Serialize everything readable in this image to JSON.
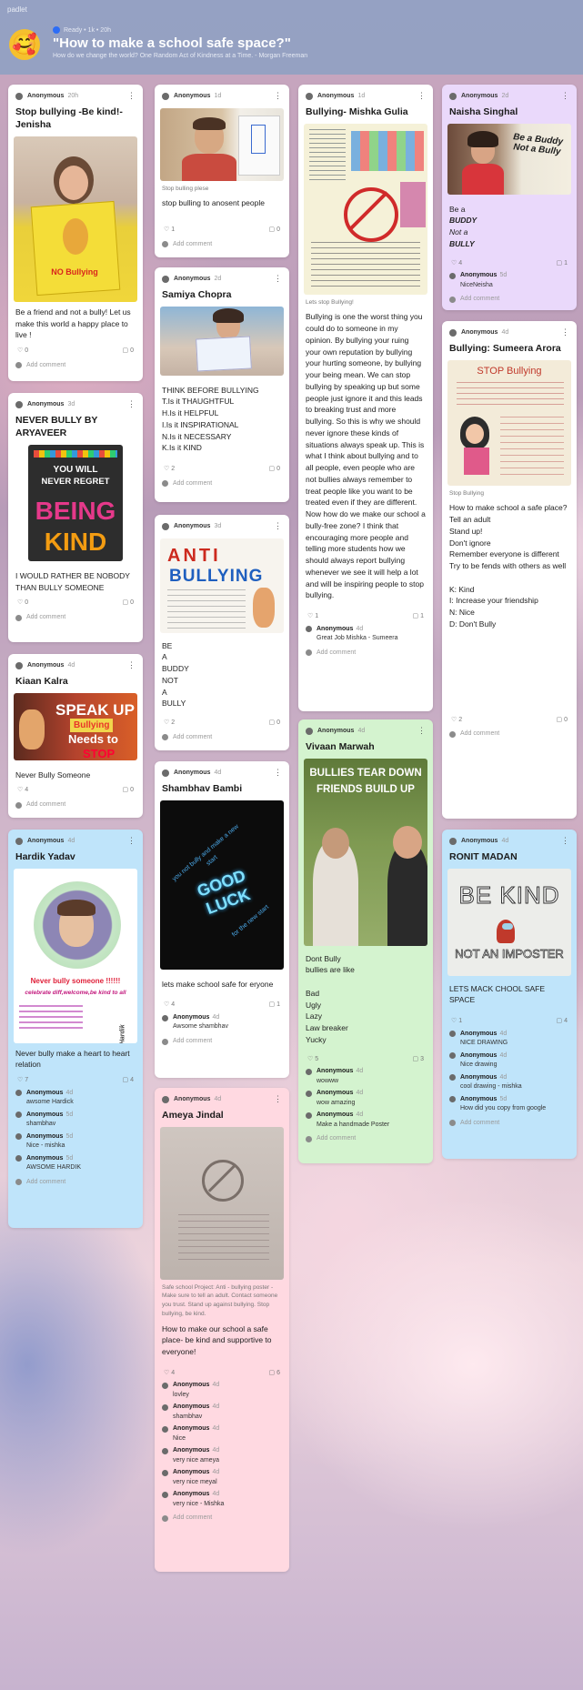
{
  "header": {
    "brand": "padlet",
    "owner_meta": "Ready • 1k • 20h",
    "title": "\"How to make a school safe space?\"",
    "subtitle": "How do we change the world? One Random Act of Kindness at a Time. - Morgan Freeman"
  },
  "posts": {
    "p1": {
      "author": "Anonymous",
      "time": "20h",
      "title": "Stop bullying -Be kind!- Jenisha",
      "body": "Be a friend and not a bully! Let us make this world a happy place to live !",
      "likes": "0",
      "comments": "0",
      "add": "Add comment",
      "img_text": "NO Bullying"
    },
    "p2": {
      "author": "Anonymous",
      "time": "1d",
      "caption": "Stop bulling plese",
      "body": "stop bulling to anosent people",
      "likes": "1",
      "comments": "0",
      "add": "Add comment"
    },
    "p3": {
      "author": "Anonymous",
      "time": "1d",
      "title": "Bullying- Mishka Gulia",
      "caption": "Lets stop Bullying!",
      "body": "Bullying is one the worst thing you could do to someone in my opinion. By bullying your ruing your own reputation by bullying your hurting someone, by bullying your being mean. We can stop bullying by speaking up but some people just ignore it and this leads to breaking trust and more bullying. So this is why we should never ignore these kinds of situations always speak up. This is what I think about bullying and to all people, even people who are not bullies always remember to treat people like you want to be treated even if they are different. Now how do we make our school a bully-free zone? I think that encouraging more people and telling more students how we should always report bullying whenever we see it will help a lot and will be inspiring people to stop bullying.",
      "likes": "1",
      "comments": "1",
      "add": "Add comment",
      "c1_name": "Anonymous",
      "c1_time": "4d",
      "c1_text": "Great Job Mishka - Sumeera"
    },
    "p4": {
      "author": "Anonymous",
      "time": "2d",
      "title": "Naisha Singhal",
      "b1": "Be a",
      "b2": "BUDDY",
      "b3": "Not a",
      "b4": "BULLY",
      "likes": "4",
      "comments": "1",
      "add": "Add comment",
      "c1_name": "Anonymous",
      "c1_time": "5d",
      "c1_text": "NiceNeisha",
      "img_text": "Be a Buddy Not a Bully"
    },
    "p5": {
      "author": "Anonymous",
      "time": "2d",
      "title": "Samiya Chopra",
      "lines": [
        "THINK BEFORE BULLYING",
        "T.Is it THAUGHTFUL",
        "H.Is it HELPFUL",
        "I.Is it INSPIRATIONAL",
        "N.Is it NECESSARY",
        "K.Is it KIND"
      ],
      "likes": "2",
      "comments": "0",
      "add": "Add comment"
    },
    "p6": {
      "author": "Anonymous",
      "time": "3d",
      "title": "NEVER BULLY BY ARYAVEER",
      "img_l1": "YOU WILL",
      "img_l2": "NEVER REGRET",
      "img_l3": "BEING",
      "img_l4": "KIND",
      "body": "I WOULD RATHER BE NOBODY THAN BULLY SOMEONE",
      "likes": "0",
      "comments": "0",
      "add": "Add comment"
    },
    "p7": {
      "author": "Anonymous",
      "time": "3d",
      "img_l1": "ANTI",
      "img_l2": "BULLYING",
      "lines": [
        "BE",
        "A",
        "BUDDY",
        "NOT",
        "A",
        "BULLY"
      ],
      "likes": "2",
      "comments": "0",
      "add": "Add comment"
    },
    "p8": {
      "author": "Anonymous",
      "time": "4d",
      "title": "Sumeera Arora",
      "title_prefix": "Bullying: ",
      "caption": "Stop Bullying",
      "body1": "How to make school a safe place?",
      "body2": "Tell an adult",
      "body3": "Stand up!",
      "body4": "Don't ignore",
      "body5": "Remember everyone is different",
      "body6": "Try to be fends with others as well",
      "body7": "K: Kind",
      "body8": "I: Increase your friendship",
      "body9": "N: Nice",
      "body10": "D: Don't Bully",
      "likes": "2",
      "comments": "0",
      "add": "Add comment",
      "img_text": "STOP Bullying"
    },
    "p9": {
      "author": "Anonymous",
      "time": "4d",
      "title": "Kiaan Kalra",
      "img_l1": "SPEAK UP",
      "img_l2": "Bullying",
      "img_l3": "Needs to",
      "img_l4": "STOP",
      "body": "Never Bully Someone",
      "likes": "4",
      "comments": "0",
      "add": "Add comment"
    },
    "p10": {
      "author": "Anonymous",
      "time": "4d",
      "title": "Shambhav Bambi",
      "img_l1": "GOOD",
      "img_l2": "LUCK",
      "img_l3": "you not bully and make a new start",
      "img_l4": "for the new start",
      "body": "lets make school safe for eryone",
      "likes": "4",
      "comments": "1",
      "add": "Add comment",
      "c1_name": "Anonymous",
      "c1_time": "4d",
      "c1_text": "Awsome shambhav"
    },
    "p11": {
      "author": "Anonymous",
      "time": "4d",
      "title": "Vivaan Marwah",
      "img_l1": "BULLIES TEAR DOWN",
      "img_l2": "FRIENDS BUILD UP",
      "body": [
        "Dont Bully",
        "bullies are like",
        "",
        "Bad",
        "Ugly",
        "Lazy",
        "Law breaker",
        "Yucky"
      ],
      "likes": "5",
      "comments": "3",
      "add": "Add comment",
      "cms": [
        {
          "n": "Anonymous",
          "t": "4d",
          "x": "wowww"
        },
        {
          "n": "Anonymous",
          "t": "4d",
          "x": "wow amazing"
        },
        {
          "n": "Anonymous",
          "t": "4d",
          "x": "Make a handmade Poster"
        }
      ]
    },
    "p12": {
      "author": "Anonymous",
      "time": "4d",
      "title": "RONIT MADAN",
      "img_l1": "BE KIND",
      "img_l2": "NOT AN IMPOSTER",
      "body": "LETS MACK CHOOL SAFE SPACE",
      "likes": "1",
      "comments": "4",
      "add": "Add comment",
      "cms": [
        {
          "n": "Anonymous",
          "t": "4d",
          "x": "NICE DRAWING"
        },
        {
          "n": "Anonymous",
          "t": "4d",
          "x": "Nice drawing"
        },
        {
          "n": "Anonymous",
          "t": "4d",
          "x": "cool drawing - mishka"
        },
        {
          "n": "Anonymous",
          "t": "5d",
          "x": "How did you copy from google"
        }
      ]
    },
    "p13": {
      "author": "Anonymous",
      "time": "4d",
      "title": "Hardik Yadav",
      "img_l1": "Never bully someone !!!!!!",
      "img_l2": "celebrate diff,welcome,be kind to all",
      "img_l3": "Hardik",
      "body": "Never bully make a heart to heart relation",
      "likes": "7",
      "comments": "4",
      "add": "Add comment",
      "cms": [
        {
          "n": "Anonymous",
          "t": "4d",
          "x": "awsome Hardick"
        },
        {
          "n": "Anonymous",
          "t": "5d",
          "x": "shambhav"
        },
        {
          "n": "Anonymous",
          "t": "5d",
          "x": "Nice - mishka"
        },
        {
          "n": "Anonymous",
          "t": "5d",
          "x": "AWSOME HARDIK"
        }
      ]
    },
    "p14": {
      "author": "Anonymous",
      "time": "4d",
      "title": "Ameya Jindal",
      "caption": "Safe school Project: Anti - bullying poster - Make sure to tell an adult. Contact someone you trust. Stand up against bullying. Stop bullying, be kind.",
      "body": "How to make our school a safe place- be kind and supportive to everyone!",
      "likes": "4",
      "comments": "6",
      "add": "Add comment",
      "cms": [
        {
          "n": "Anonymous",
          "t": "4d",
          "x": "lovley"
        },
        {
          "n": "Anonymous",
          "t": "4d",
          "x": "shambhav"
        },
        {
          "n": "Anonymous",
          "t": "4d",
          "x": "Nice"
        },
        {
          "n": "Anonymous",
          "t": "4d",
          "x": "very nice ameya"
        },
        {
          "n": "Anonymous",
          "t": "4d",
          "x": "very nice meyal"
        },
        {
          "n": "Anonymous",
          "t": "4d",
          "x": "very nice - Mishka"
        }
      ]
    }
  }
}
